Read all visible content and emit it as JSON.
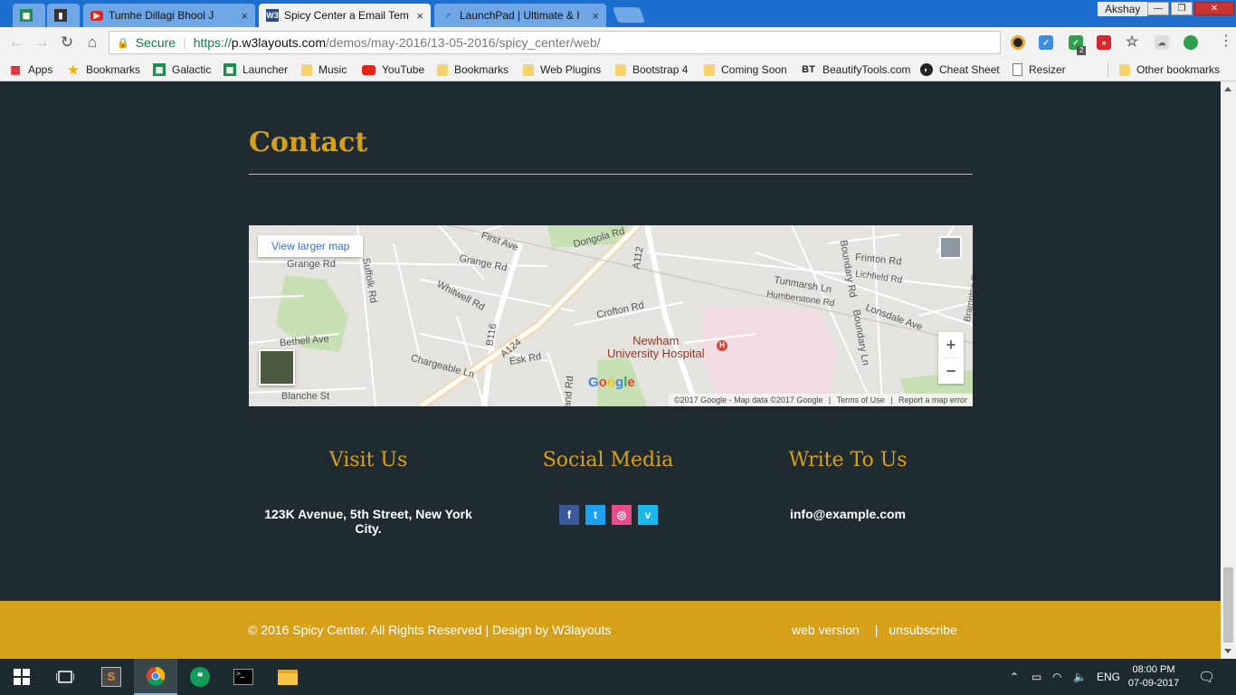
{
  "browser": {
    "tabs": [
      {
        "title": "Tumhe Dillagi Bhool J"
      },
      {
        "title": "Spicy Center a Email Tem"
      },
      {
        "title": "LaunchPad | Ultimate & I"
      }
    ],
    "profile_name": "Akshay",
    "secure_label": "Secure",
    "url_scheme": "https://",
    "url_host": "p.w3layouts.com",
    "url_path": "/demos/may-2016/13-05-2016/spicy_center/web/",
    "extension_badge": "2"
  },
  "bookmarks": {
    "items": [
      {
        "label": "Apps",
        "icon": "apps-grid-icon"
      },
      {
        "label": "Bookmarks",
        "icon": "star-icon"
      },
      {
        "label": "Galactic",
        "icon": "sheet-icon"
      },
      {
        "label": "Launcher",
        "icon": "sheet-icon"
      },
      {
        "label": "Music",
        "icon": "folder-icon"
      },
      {
        "label": "YouTube",
        "icon": "youtube-icon"
      },
      {
        "label": "Bookmarks",
        "icon": "folder-icon"
      },
      {
        "label": "Web Plugins",
        "icon": "folder-icon"
      },
      {
        "label": "Bootstrap 4",
        "icon": "folder-icon"
      },
      {
        "label": "Coming Soon",
        "icon": "folder-icon"
      },
      {
        "label": "BeautifyTools.com",
        "icon": "bt-icon"
      },
      {
        "label": "Cheat Sheet",
        "icon": "cheatsheet-icon"
      },
      {
        "label": "Resizer",
        "icon": "page-icon"
      }
    ],
    "other": "Other bookmarks"
  },
  "page": {
    "contact_heading": "Contact",
    "map": {
      "view_larger": "View larger map",
      "hospital_line1": "Newham",
      "hospital_line2": "University Hospital",
      "hospital_marker": "H",
      "google": "Google",
      "zoom_in": "+",
      "zoom_out": "−",
      "attribution": "©2017 Google - Map data ©2017 Google",
      "terms": "Terms of Use",
      "report": "Report a map error",
      "streets": {
        "first_ave": "First Ave",
        "dongola": "Dongola Rd",
        "a112": "A112",
        "boundary_rd": "Boundary Rd",
        "frinton": "Frinton Rd",
        "lichfield": "Lichfield Rd",
        "grange1": "Grange Rd",
        "grange2": "Grange Rd",
        "suffolk": "Suffolk Rd",
        "whitwell": "Whitwell Rd",
        "tunmarsh": "Tunmarsh Ln",
        "humberstone": "Humberstone Rd",
        "lonsdale": "Lonsdale Ave",
        "brampton": "Brampton Rd",
        "crofton": "Crofton Rd",
        "b116": "B116",
        "a124": "A124",
        "bethell": "Bethell Ave",
        "chargeable": "Chargeable Ln",
        "esk": "Esk Rd",
        "blanche": "Blanche St",
        "boundary_ln": "Boundary Ln",
        "and_rd": "and Rd"
      }
    },
    "visit_title": "Visit Us",
    "visit_text": "123K Avenue, 5th Street, New York City.",
    "social_title": "Social Media",
    "social_icons": {
      "facebook": "f",
      "twitter": "t",
      "dribbble": "◎",
      "vimeo": "v"
    },
    "write_title": "Write To Us",
    "write_text": "info@example.com",
    "copyright": "© 2016 Spicy Center. All Rights Reserved | Design by W3layouts",
    "web_version": "web version",
    "separator": "|",
    "unsubscribe": "unsubscribe"
  },
  "taskbar": {
    "language": "ENG",
    "time": "08:00 PM",
    "date": "07-09-2017"
  },
  "colors": {
    "accent_gold": "#d6a019",
    "page_bg": "#1f2b31",
    "chrome_blue": "#1c6fcf"
  }
}
